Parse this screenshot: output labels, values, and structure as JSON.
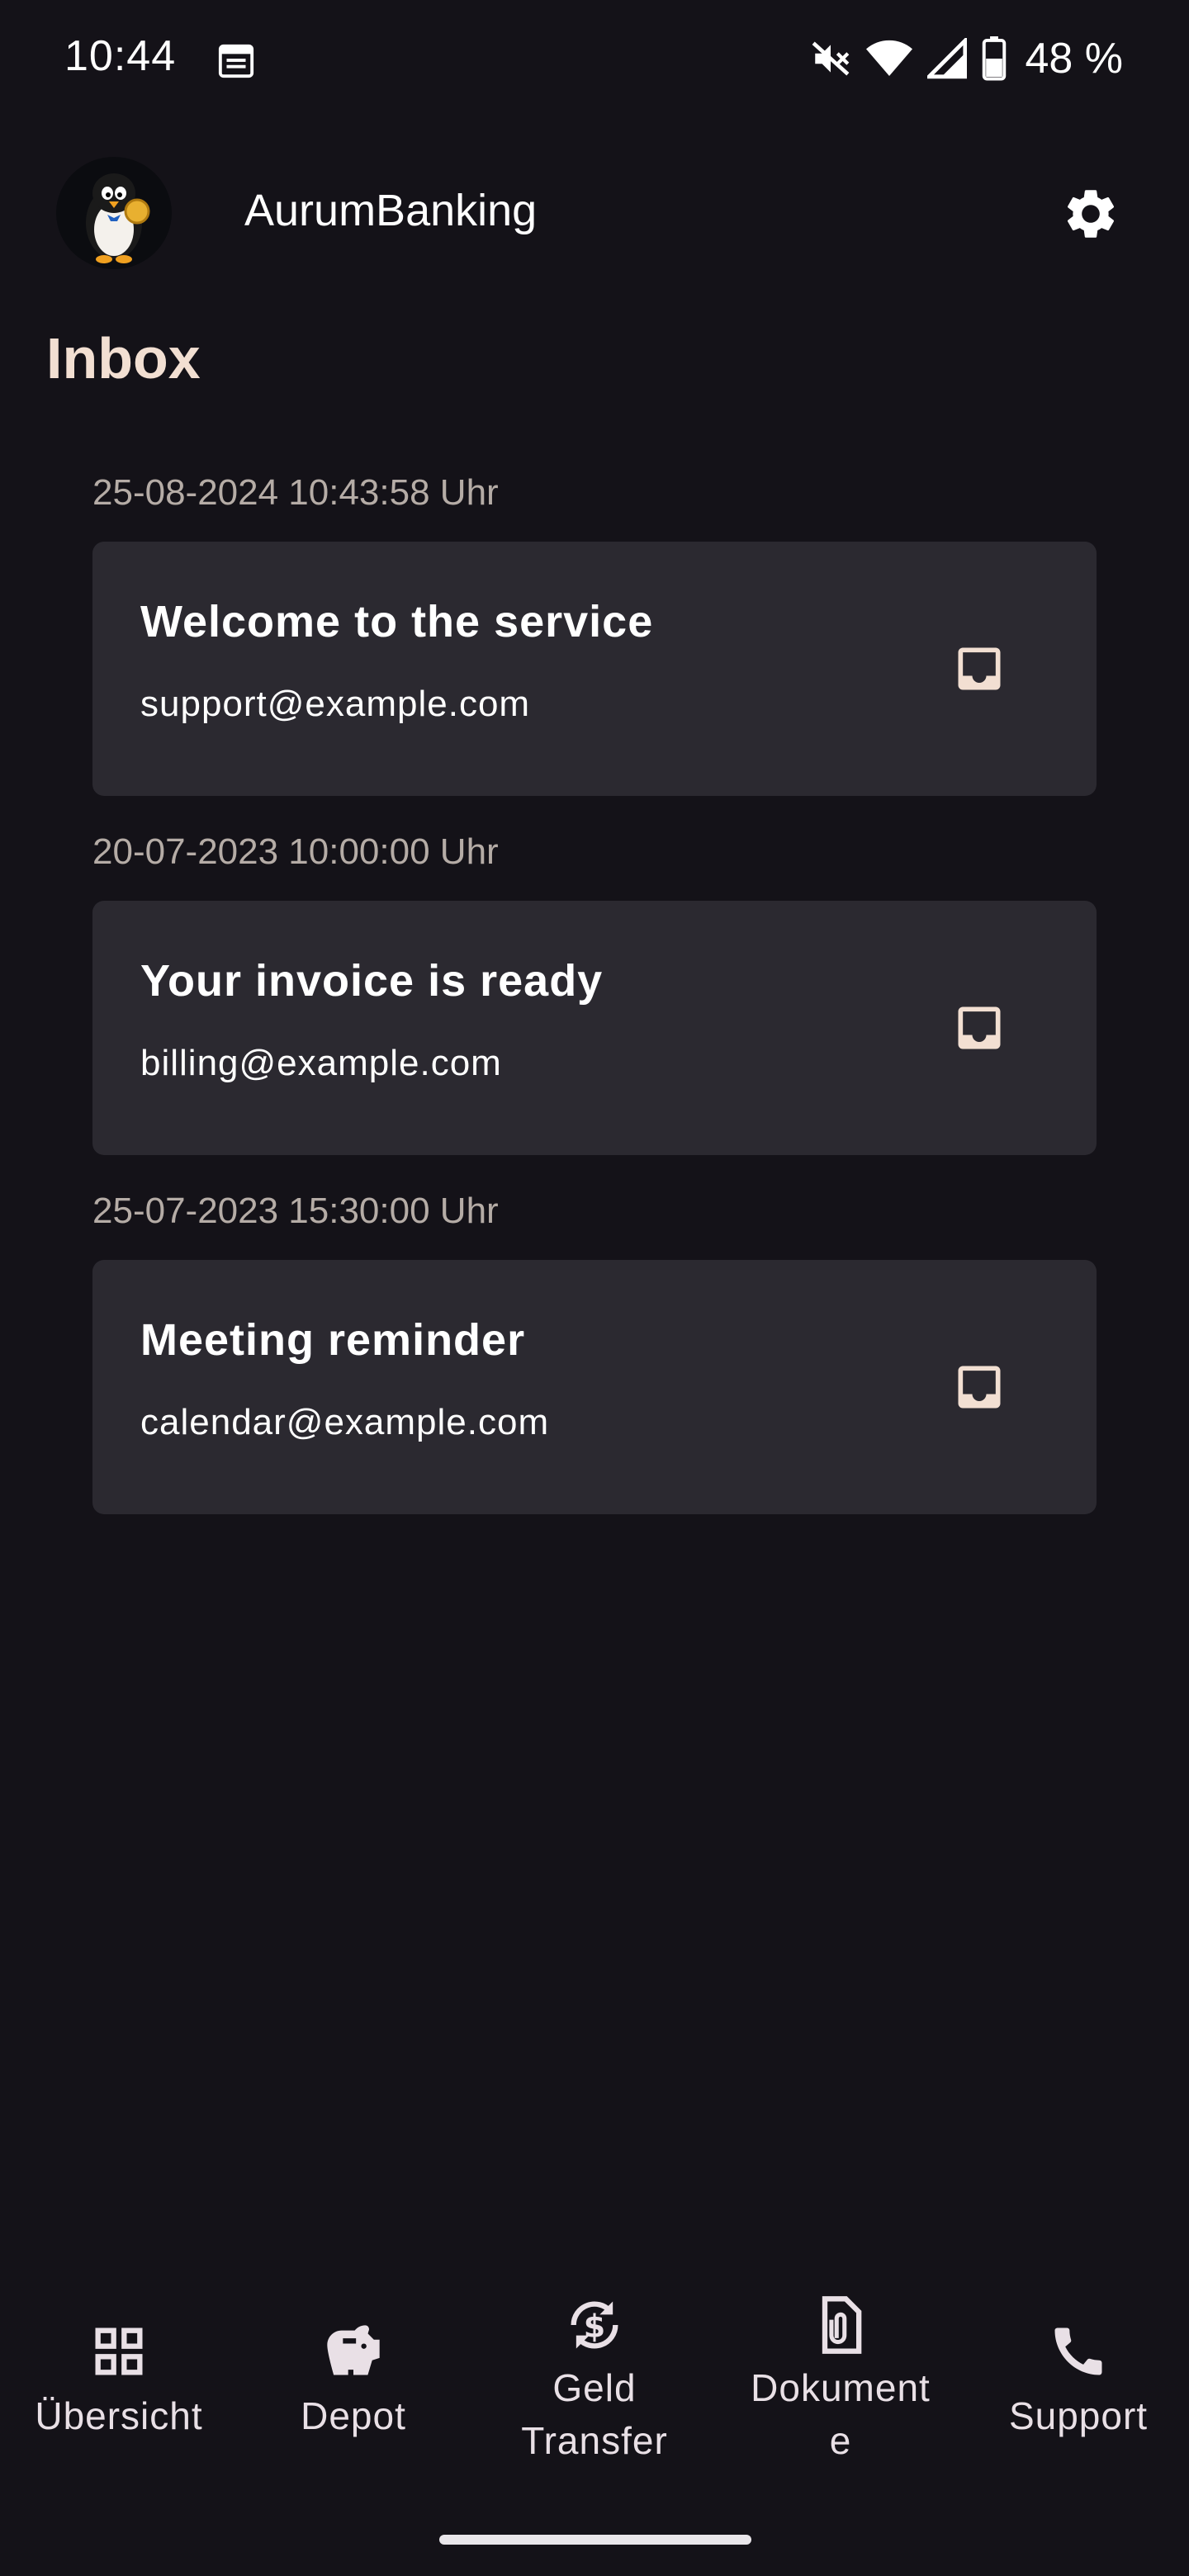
{
  "status_bar": {
    "time": "10:44",
    "battery_percent": "48 %",
    "icons": [
      "calendar-icon",
      "mute-icon",
      "wifi-icon",
      "signal-icon",
      "battery-icon"
    ]
  },
  "app_bar": {
    "title": "AurumBanking",
    "avatar_icon": "penguin-logo",
    "settings_icon": "gear-icon"
  },
  "page": {
    "title": "Inbox"
  },
  "messages": [
    {
      "date": "25-08-2024 10:43:58 Uhr",
      "subject": "Welcome to the service",
      "sender": "support@example.com",
      "icon": "inbox-icon"
    },
    {
      "date": "20-07-2023 10:00:00 Uhr",
      "subject": "Your invoice is ready",
      "sender": "billing@example.com",
      "icon": "inbox-icon"
    },
    {
      "date": "25-07-2023 15:30:00 Uhr",
      "subject": "Meeting reminder",
      "sender": "calendar@example.com",
      "icon": "inbox-icon"
    }
  ],
  "bottom_nav": [
    {
      "label": "Übersicht",
      "icon": "grid-icon"
    },
    {
      "label": "Depot",
      "icon": "piggy-bank-icon"
    },
    {
      "label_line1": "Geld",
      "label_line2": "Transfer",
      "icon": "currency-exchange-icon"
    },
    {
      "label_line1": "Dokument",
      "label_line2": "e",
      "icon": "document-clip-icon"
    },
    {
      "label": "Support",
      "icon": "phone-icon"
    }
  ],
  "colors": {
    "background": "#141218",
    "card": "#2b2930",
    "title_accent": "#f2dfd2",
    "date_text": "#b5aca6",
    "inbox_icon": "#f2dfd2"
  }
}
